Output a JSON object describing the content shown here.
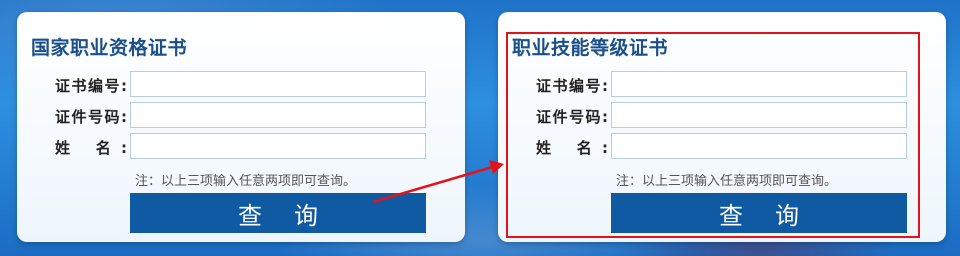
{
  "left_card": {
    "title": "国家职业资格证书",
    "cert_no_label": "证书编号:",
    "id_no_label": "证件号码:",
    "name_label": "姓 名:",
    "note": "注：以上三项输入任意两项即可查询。",
    "query_label": "查询"
  },
  "right_card": {
    "title": "职业技能等级证书",
    "cert_no_label": "证书编号:",
    "id_no_label": "证件号码:",
    "name_label": "姓 名:",
    "note": "注：以上三项输入任意两项即可查询。",
    "query_label": "查询"
  },
  "colors": {
    "accent": "#0f5aa3",
    "highlight": "#e3131b",
    "title": "#1a4f8a"
  }
}
